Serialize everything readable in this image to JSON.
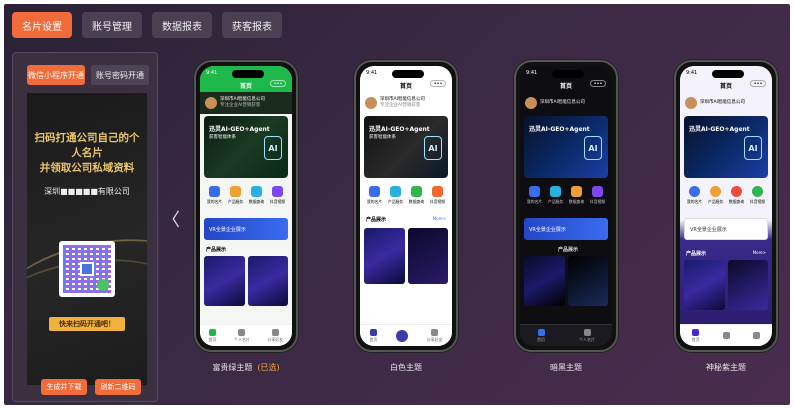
{
  "tabs": [
    "名片设置",
    "账号管理",
    "数据报表",
    "获客报表"
  ],
  "left": {
    "seg": [
      "微信小程序开通",
      "账号密码开通"
    ],
    "card_title_1": "扫码打通公司自己的个人名片",
    "card_title_2": "并领取公司私域资料",
    "card_company": "深圳■■■■■有限公司",
    "card_banner": "快来扫码开通吧！",
    "btn_generate": "生成并下载",
    "btn_refresh": "刷新二维码"
  },
  "phone_common": {
    "status_time": "9:41",
    "nav_title": "首页",
    "nav_dots": "•••",
    "profile_name": "深圳市AI智能信息公司",
    "profile_desc": "专注企业AI营销获客",
    "banner_text_1": "迅灵AI-GEO+Agent",
    "banner_text_2": "获客智能体系",
    "banner_ai": "AI",
    "icons": [
      "我的名片",
      "产品服务",
      "数据查询",
      "抖音视频"
    ],
    "promo": "VR全景企业展示",
    "sec_title": "产品展示",
    "sec_more": "More>",
    "tabbar": [
      "首页",
      "个人名片",
      "分享好友"
    ]
  },
  "phones": [
    {
      "label": "富贵绿主题",
      "selected": "(已选)"
    },
    {
      "label": "白色主题",
      "selected": ""
    },
    {
      "label": "暗黑主题",
      "selected": ""
    },
    {
      "label": "神秘紫主题",
      "selected": ""
    }
  ],
  "arrow": "〈"
}
